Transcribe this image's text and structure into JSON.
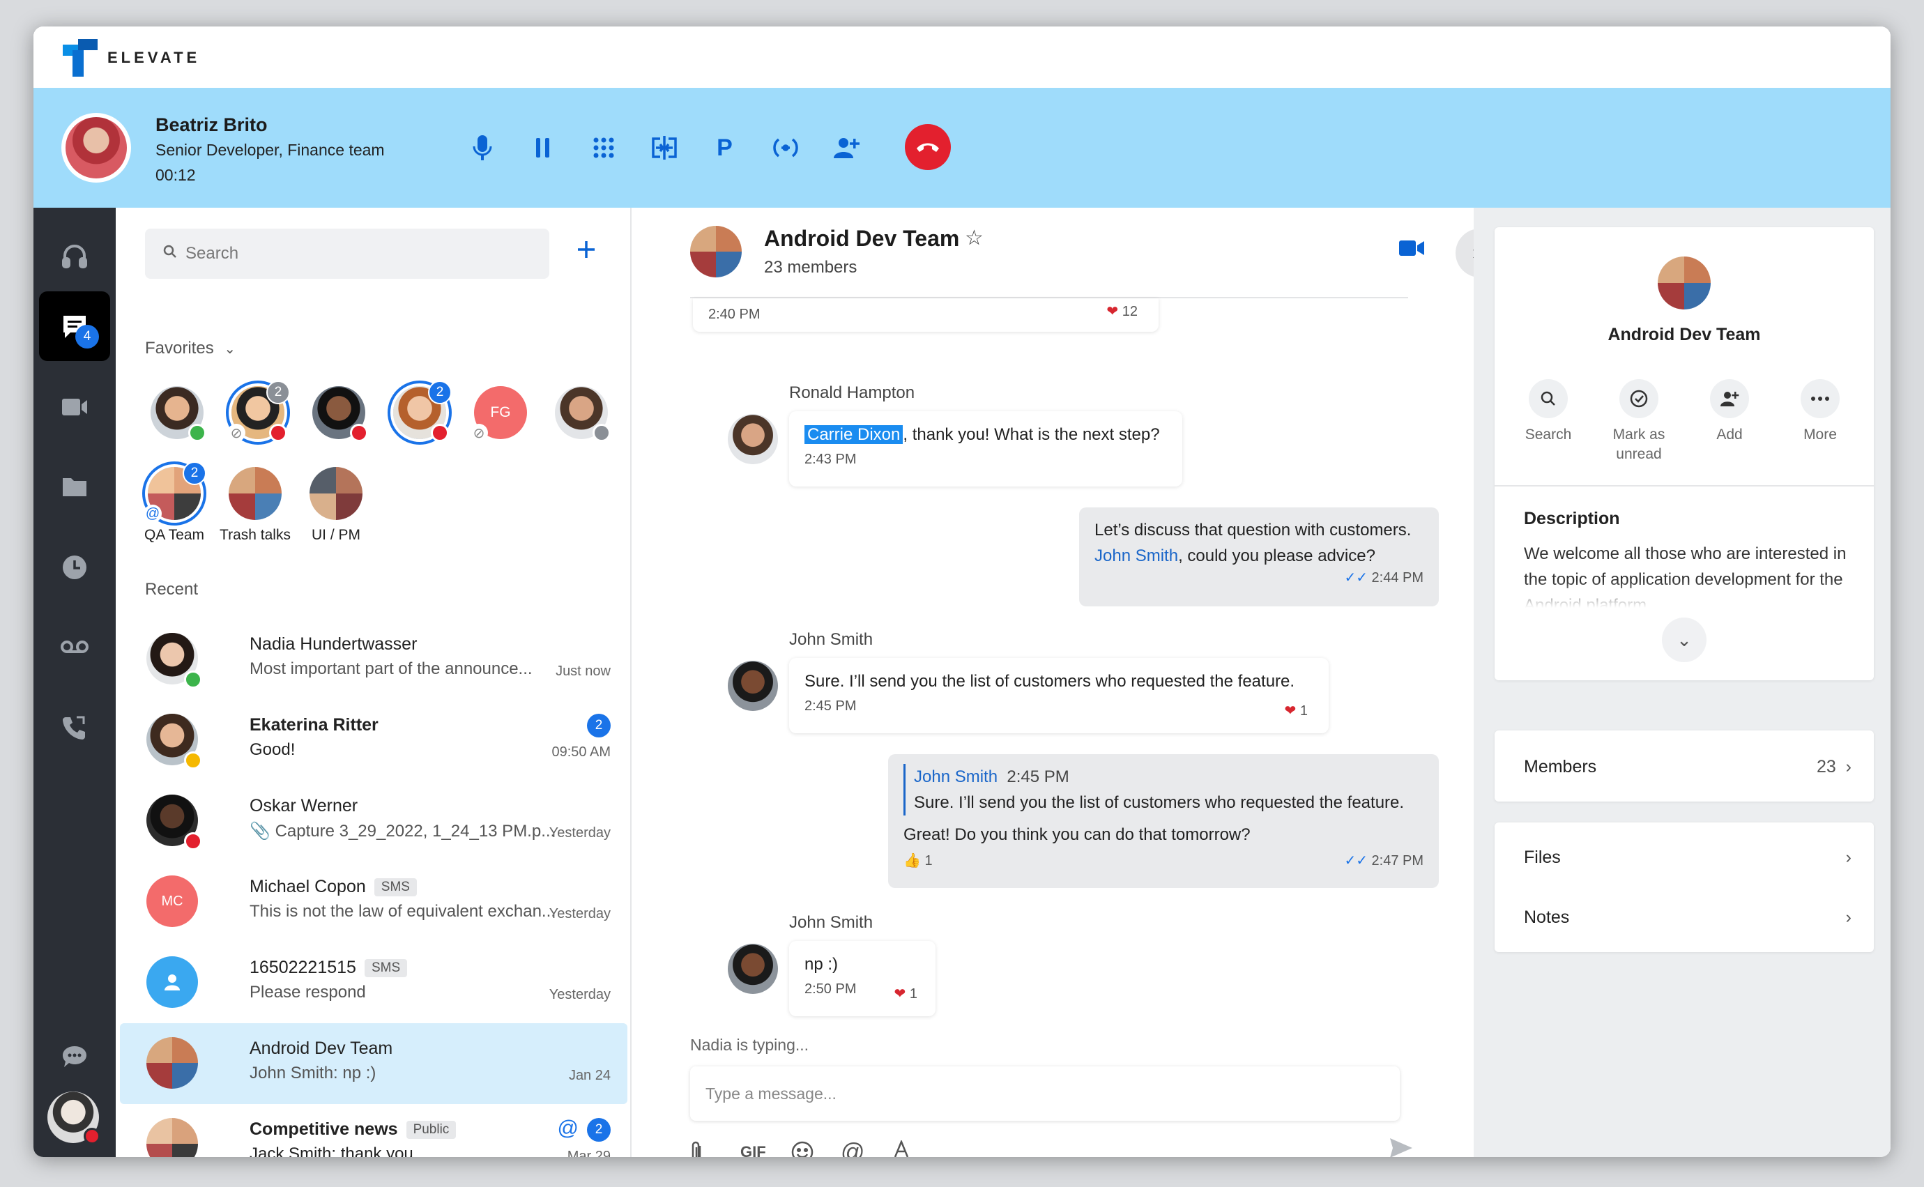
{
  "app": {
    "brand": "ELEVATE"
  },
  "call": {
    "name": "Beatriz Brito",
    "role": "Senior Developer, Finance team",
    "duration": "00:12",
    "controls": [
      "mic-icon",
      "pause-icon",
      "dialpad-icon",
      "transfer-icon",
      "park-icon",
      "merge-icon",
      "add-person-icon"
    ],
    "park_label": "P",
    "hangup_icon": "phone-hangup-icon"
  },
  "rail": {
    "chat_badge": "4"
  },
  "list": {
    "search_placeholder": "Search",
    "favorites_label": "Favorites",
    "recent_label": "Recent",
    "favorites": [
      {
        "label": "",
        "badge": "",
        "status": "#3cb44b"
      },
      {
        "label": "",
        "badge": "2",
        "status": "#e3202e"
      },
      {
        "label": "",
        "badge": "",
        "status": "#e3202e"
      },
      {
        "label": "",
        "badge": "2",
        "status": "#e3202e"
      },
      {
        "label": "FG",
        "badge": "",
        "status": ""
      },
      {
        "label": "",
        "badge": "",
        "status": "#8a8f96"
      },
      {
        "label": "QA Team",
        "badge": "2"
      },
      {
        "label": "Trash talks",
        "badge": ""
      },
      {
        "label": "UI / PM",
        "badge": ""
      }
    ],
    "conversations": [
      {
        "name": "Nadia Hundertwasser",
        "preview": "Most important part of the announce...",
        "time": "Just now",
        "bold": false
      },
      {
        "name": "Ekaterina Ritter",
        "preview": "Good!",
        "time": "09:50 AM",
        "count": "2",
        "bold": true
      },
      {
        "name": "Oskar Werner",
        "preview": "Capture 3_29_2022, 1_24_13 PM.p...",
        "time": "Yesterday",
        "bold": false
      },
      {
        "name": "Michael Copon",
        "tag": "SMS",
        "initials": "MC",
        "preview": "This is not the law of equivalent exchan...",
        "time": "Yesterday",
        "bold": false
      },
      {
        "name": "16502221515",
        "tag": "SMS",
        "preview": "Please respond",
        "time": "Yesterday",
        "bold": false
      },
      {
        "name": "Android Dev Team",
        "preview": "John Smith: np :)",
        "time": "Jan 24",
        "bold": false
      },
      {
        "name": "Competitive news",
        "tag": "Public",
        "preview": "Jack Smith: thank you",
        "time": "Mar 29",
        "count": "2",
        "mention": "@",
        "bold": true
      }
    ]
  },
  "chat": {
    "title": "Android Dev Team",
    "members": "23 members",
    "typing": "Nadia is typing...",
    "compose_placeholder": "Type a message...",
    "gif_label": "GIF",
    "messages": {
      "m0_time": "2:40 PM",
      "m0_reacts": "12",
      "m1_sender": "Ronald Hampton",
      "m1_mention": "Carrie Dixon",
      "m1_text": ", thank you! What is the next step?",
      "m1_time": "2:43 PM",
      "m2_text_a": "Let’s discuss that question with customers.",
      "m2_mention": "John Smith",
      "m2_text_b": ", could you please advice?",
      "m2_time": "2:44 PM",
      "m3_sender": "John Smith",
      "m3_text": "Sure. I’ll send you the list of customers who requested the feature.",
      "m3_time": "2:45 PM",
      "m3_reacts": "1",
      "m4_quote_name": "John Smith",
      "m4_quote_time": "2:45 PM",
      "m4_quote_text": "Sure. I’ll send you the list of customers who requested the feature.",
      "m4_text": "Great! Do you think you can do that tomorrow?",
      "m4_time": "2:47 PM",
      "m4_reacts": "1",
      "m5_sender": "John Smith",
      "m5_text": "np :)",
      "m5_time": "2:50 PM",
      "m5_reacts": "1"
    }
  },
  "details": {
    "title": "Android Dev Team",
    "actions": [
      {
        "icon": "search-icon",
        "label": "Search"
      },
      {
        "icon": "check-circle-icon",
        "label": "Mark as unread"
      },
      {
        "icon": "add-person-icon",
        "label": "Add"
      },
      {
        "icon": "more-icon",
        "label": "More"
      }
    ],
    "description_heading": "Description",
    "description": "We welcome all those who are interested in the topic of application development for the Android platform.",
    "members_label": "Members",
    "members_count": "23",
    "files_label": "Files",
    "notes_label": "Notes"
  },
  "colors": {
    "accent": "#1a73e8",
    "callbar": "#9fdcfb",
    "hangup": "#e3202e",
    "rail": "#2b2f36"
  }
}
